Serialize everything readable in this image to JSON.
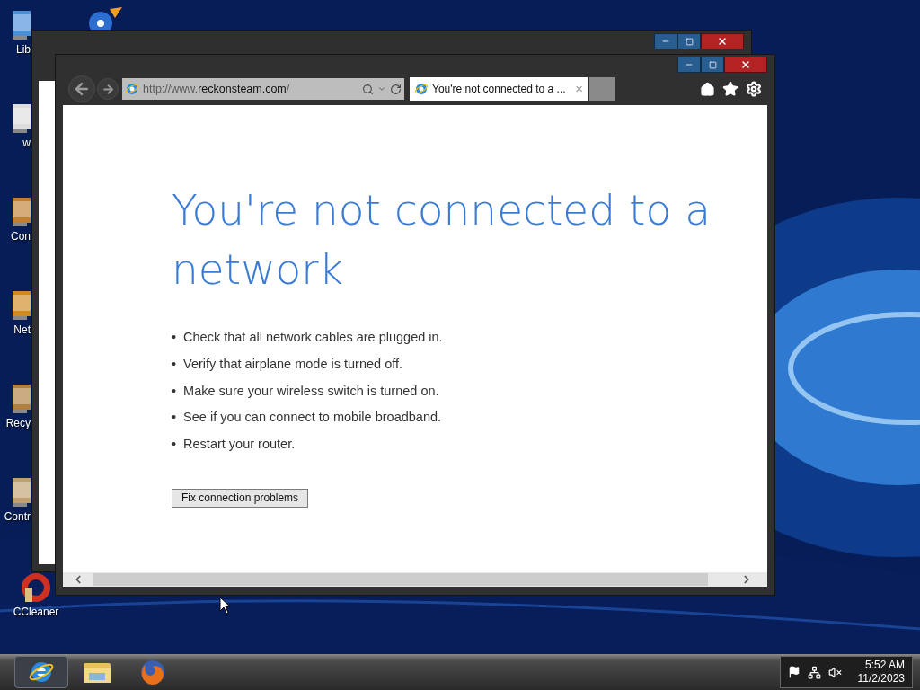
{
  "desktop_icons": [
    {
      "label": "Lib",
      "kind": "library"
    },
    {
      "label": "w",
      "kind": "document"
    },
    {
      "label": "Con",
      "kind": "computer"
    },
    {
      "label": "Net",
      "kind": "network"
    },
    {
      "label": "Recy",
      "kind": "recycle"
    },
    {
      "label": "Contr",
      "kind": "control"
    },
    {
      "label": "CCleaner",
      "kind": "cleaner"
    }
  ],
  "browser": {
    "address": {
      "prefix": "http://www.",
      "domain": "reckonsteam.com",
      "suffix": "/"
    },
    "tabs": [
      {
        "title": "You're not connected to a ...",
        "selected": true,
        "close": "×"
      }
    ],
    "page": {
      "heading": "You're not connected to a network",
      "bullets": [
        "Check that all network cables are plugged in.",
        "Verify that airplane mode is turned off.",
        "Make sure your wireless switch is turned on.",
        "See if you can connect to mobile broadband.",
        "Restart your router."
      ],
      "bullet_mark": "•",
      "button": "Fix connection problems"
    }
  },
  "taskbar": {
    "apps": [
      {
        "kind": "ie",
        "selected": true
      },
      {
        "kind": "explorer",
        "selected": false
      },
      {
        "kind": "firefox",
        "selected": false
      }
    ],
    "clock": {
      "time": "5:52 AM",
      "date": "11/2/2023"
    }
  }
}
